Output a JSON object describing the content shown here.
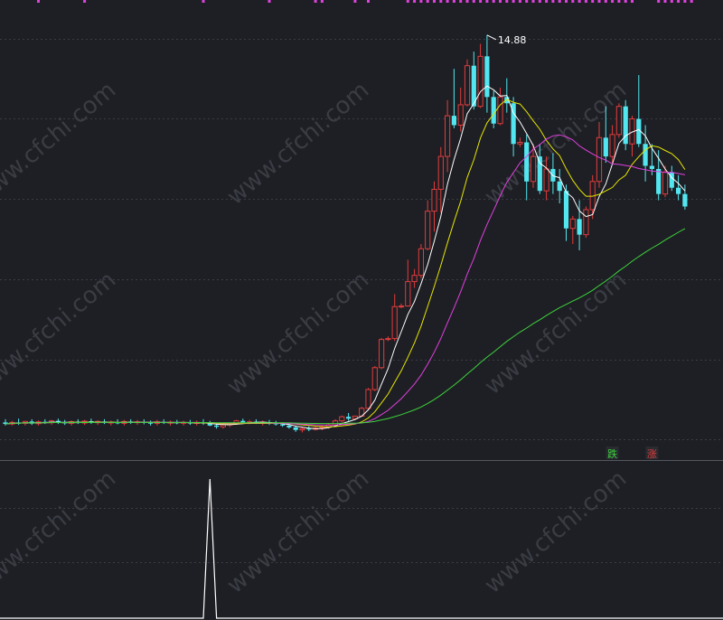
{
  "watermark": "www.cfchi.com",
  "colors": {
    "background": "#1e1f24",
    "grid": "#3a3c46",
    "up": "#e03c3c",
    "down": "#52e6f0",
    "ma5": "#ffffff",
    "ma10": "#e6e600",
    "ma20": "#e040e0",
    "ma60": "#3cd23c",
    "signal_marks": "#e040e0",
    "indicator_line": "#ffffff"
  },
  "chart_data": [
    {
      "type": "candlestick",
      "title": "",
      "max_label": "14.88",
      "ylim": [
        1.5,
        16.0
      ],
      "series_lines": [
        "MA5",
        "MA10",
        "MA20",
        "MA60"
      ],
      "candles": [
        {
          "o": 2.5,
          "h": 2.6,
          "l": 2.4,
          "c": 2.45
        },
        {
          "o": 2.45,
          "h": 2.55,
          "l": 2.4,
          "c": 2.5
        },
        {
          "o": 2.5,
          "h": 2.62,
          "l": 2.42,
          "c": 2.47
        },
        {
          "o": 2.47,
          "h": 2.55,
          "l": 2.4,
          "c": 2.53
        },
        {
          "o": 2.53,
          "h": 2.6,
          "l": 2.42,
          "c": 2.46
        },
        {
          "o": 2.46,
          "h": 2.56,
          "l": 2.4,
          "c": 2.52
        },
        {
          "o": 2.52,
          "h": 2.6,
          "l": 2.45,
          "c": 2.49
        },
        {
          "o": 2.49,
          "h": 2.58,
          "l": 2.42,
          "c": 2.55
        },
        {
          "o": 2.55,
          "h": 2.62,
          "l": 2.45,
          "c": 2.5
        },
        {
          "o": 2.5,
          "h": 2.58,
          "l": 2.42,
          "c": 2.47
        },
        {
          "o": 2.47,
          "h": 2.56,
          "l": 2.4,
          "c": 2.52
        },
        {
          "o": 2.52,
          "h": 2.6,
          "l": 2.45,
          "c": 2.48
        },
        {
          "o": 2.48,
          "h": 2.58,
          "l": 2.42,
          "c": 2.54
        },
        {
          "o": 2.54,
          "h": 2.62,
          "l": 2.45,
          "c": 2.49
        },
        {
          "o": 2.49,
          "h": 2.57,
          "l": 2.42,
          "c": 2.53
        },
        {
          "o": 2.53,
          "h": 2.6,
          "l": 2.45,
          "c": 2.48
        },
        {
          "o": 2.48,
          "h": 2.56,
          "l": 2.4,
          "c": 2.51
        },
        {
          "o": 2.51,
          "h": 2.6,
          "l": 2.44,
          "c": 2.47
        },
        {
          "o": 2.47,
          "h": 2.58,
          "l": 2.4,
          "c": 2.53
        },
        {
          "o": 2.53,
          "h": 2.6,
          "l": 2.45,
          "c": 2.5
        },
        {
          "o": 2.5,
          "h": 2.58,
          "l": 2.42,
          "c": 2.52
        },
        {
          "o": 2.52,
          "h": 2.6,
          "l": 2.44,
          "c": 2.49
        },
        {
          "o": 2.49,
          "h": 2.56,
          "l": 2.4,
          "c": 2.47
        },
        {
          "o": 2.47,
          "h": 2.58,
          "l": 2.4,
          "c": 2.52
        },
        {
          "o": 2.52,
          "h": 2.6,
          "l": 2.45,
          "c": 2.48
        },
        {
          "o": 2.48,
          "h": 2.56,
          "l": 2.4,
          "c": 2.51
        },
        {
          "o": 2.51,
          "h": 2.58,
          "l": 2.44,
          "c": 2.48
        },
        {
          "o": 2.48,
          "h": 2.55,
          "l": 2.4,
          "c": 2.5
        },
        {
          "o": 2.5,
          "h": 2.58,
          "l": 2.42,
          "c": 2.47
        },
        {
          "o": 2.47,
          "h": 2.56,
          "l": 2.4,
          "c": 2.5
        },
        {
          "o": 2.5,
          "h": 2.6,
          "l": 2.42,
          "c": 2.48
        },
        {
          "o": 2.48,
          "h": 2.55,
          "l": 2.38,
          "c": 2.4
        },
        {
          "o": 2.4,
          "h": 2.48,
          "l": 2.3,
          "c": 2.36
        },
        {
          "o": 2.36,
          "h": 2.45,
          "l": 2.3,
          "c": 2.42
        },
        {
          "o": 2.42,
          "h": 2.5,
          "l": 2.35,
          "c": 2.48
        },
        {
          "o": 2.48,
          "h": 2.58,
          "l": 2.42,
          "c": 2.55
        },
        {
          "o": 2.55,
          "h": 2.62,
          "l": 2.45,
          "c": 2.5
        },
        {
          "o": 2.5,
          "h": 2.58,
          "l": 2.44,
          "c": 2.52
        },
        {
          "o": 2.52,
          "h": 2.6,
          "l": 2.45,
          "c": 2.48
        },
        {
          "o": 2.48,
          "h": 2.56,
          "l": 2.4,
          "c": 2.51
        },
        {
          "o": 2.51,
          "h": 2.58,
          "l": 2.42,
          "c": 2.47
        },
        {
          "o": 2.47,
          "h": 2.55,
          "l": 2.4,
          "c": 2.44
        },
        {
          "o": 2.44,
          "h": 2.5,
          "l": 2.36,
          "c": 2.4
        },
        {
          "o": 2.4,
          "h": 2.46,
          "l": 2.3,
          "c": 2.34
        },
        {
          "o": 2.34,
          "h": 2.4,
          "l": 2.2,
          "c": 2.26
        },
        {
          "o": 2.26,
          "h": 2.35,
          "l": 2.18,
          "c": 2.3
        },
        {
          "o": 2.3,
          "h": 2.38,
          "l": 2.22,
          "c": 2.28
        },
        {
          "o": 2.28,
          "h": 2.36,
          "l": 2.24,
          "c": 2.32
        },
        {
          "o": 2.32,
          "h": 2.4,
          "l": 2.25,
          "c": 2.35
        },
        {
          "o": 2.35,
          "h": 2.45,
          "l": 2.3,
          "c": 2.42
        },
        {
          "o": 2.42,
          "h": 2.6,
          "l": 2.4,
          "c": 2.55
        },
        {
          "o": 2.55,
          "h": 2.72,
          "l": 2.5,
          "c": 2.68
        },
        {
          "o": 2.68,
          "h": 2.8,
          "l": 2.55,
          "c": 2.62
        },
        {
          "o": 2.62,
          "h": 2.72,
          "l": 2.58,
          "c": 2.7
        },
        {
          "o": 2.7,
          "h": 3.0,
          "l": 2.68,
          "c": 2.95
        },
        {
          "o": 2.95,
          "h": 3.6,
          "l": 2.9,
          "c": 3.55
        },
        {
          "o": 3.55,
          "h": 4.3,
          "l": 3.5,
          "c": 4.25
        },
        {
          "o": 4.25,
          "h": 5.2,
          "l": 4.2,
          "c": 5.15
        },
        {
          "o": 5.15,
          "h": 5.25,
          "l": 5.1,
          "c": 5.18
        },
        {
          "o": 5.18,
          "h": 6.6,
          "l": 5.1,
          "c": 6.2
        },
        {
          "o": 6.2,
          "h": 6.3,
          "l": 6.15,
          "c": 6.22
        },
        {
          "o": 6.22,
          "h": 7.7,
          "l": 6.2,
          "c": 7.0
        },
        {
          "o": 7.0,
          "h": 7.4,
          "l": 6.8,
          "c": 7.2
        },
        {
          "o": 7.2,
          "h": 8.2,
          "l": 7.1,
          "c": 8.05
        },
        {
          "o": 8.05,
          "h": 9.6,
          "l": 8.0,
          "c": 9.25
        },
        {
          "o": 9.25,
          "h": 10.2,
          "l": 8.6,
          "c": 9.95
        },
        {
          "o": 9.95,
          "h": 11.3,
          "l": 9.2,
          "c": 11.0
        },
        {
          "o": 11.0,
          "h": 12.8,
          "l": 10.5,
          "c": 12.3
        },
        {
          "o": 12.3,
          "h": 13.8,
          "l": 11.9,
          "c": 12.0
        },
        {
          "o": 12.0,
          "h": 13.2,
          "l": 11.8,
          "c": 12.65
        },
        {
          "o": 12.65,
          "h": 14.1,
          "l": 12.6,
          "c": 13.9
        },
        {
          "o": 13.9,
          "h": 14.35,
          "l": 12.5,
          "c": 12.6
        },
        {
          "o": 12.6,
          "h": 14.6,
          "l": 12.55,
          "c": 14.2
        },
        {
          "o": 14.2,
          "h": 14.88,
          "l": 12.4,
          "c": 12.9
        },
        {
          "o": 12.9,
          "h": 13.1,
          "l": 11.9,
          "c": 12.05
        },
        {
          "o": 12.05,
          "h": 13.2,
          "l": 12.0,
          "c": 12.9
        },
        {
          "o": 12.9,
          "h": 13.5,
          "l": 12.4,
          "c": 12.7
        },
        {
          "o": 12.7,
          "h": 12.9,
          "l": 11.0,
          "c": 11.4
        },
        {
          "o": 11.4,
          "h": 11.6,
          "l": 11.3,
          "c": 11.45
        },
        {
          "o": 11.45,
          "h": 11.7,
          "l": 9.6,
          "c": 10.2
        },
        {
          "o": 10.2,
          "h": 11.4,
          "l": 10.0,
          "c": 11.0
        },
        {
          "o": 11.0,
          "h": 11.4,
          "l": 9.8,
          "c": 9.9
        },
        {
          "o": 9.9,
          "h": 11.0,
          "l": 9.6,
          "c": 10.6
        },
        {
          "o": 10.6,
          "h": 11.1,
          "l": 9.8,
          "c": 10.2
        },
        {
          "o": 10.2,
          "h": 10.6,
          "l": 9.5,
          "c": 9.9
        },
        {
          "o": 9.9,
          "h": 10.1,
          "l": 8.3,
          "c": 8.7
        },
        {
          "o": 8.7,
          "h": 9.1,
          "l": 8.2,
          "c": 9.0
        },
        {
          "o": 9.0,
          "h": 9.6,
          "l": 8.0,
          "c": 8.5
        },
        {
          "o": 8.5,
          "h": 9.4,
          "l": 8.4,
          "c": 9.3
        },
        {
          "o": 9.3,
          "h": 10.4,
          "l": 9.0,
          "c": 10.2
        },
        {
          "o": 10.2,
          "h": 12.1,
          "l": 10.0,
          "c": 11.6
        },
        {
          "o": 11.6,
          "h": 12.6,
          "l": 10.8,
          "c": 11.0
        },
        {
          "o": 11.0,
          "h": 12.0,
          "l": 10.8,
          "c": 11.7
        },
        {
          "o": 11.7,
          "h": 12.7,
          "l": 11.6,
          "c": 12.6
        },
        {
          "o": 12.6,
          "h": 12.8,
          "l": 11.2,
          "c": 11.4
        },
        {
          "o": 11.4,
          "h": 12.3,
          "l": 11.0,
          "c": 12.2
        },
        {
          "o": 12.2,
          "h": 13.6,
          "l": 11.3,
          "c": 11.4
        },
        {
          "o": 11.4,
          "h": 12.0,
          "l": 10.2,
          "c": 10.7
        },
        {
          "o": 10.7,
          "h": 11.4,
          "l": 10.4,
          "c": 10.6
        },
        {
          "o": 10.6,
          "h": 11.2,
          "l": 9.6,
          "c": 9.8
        },
        {
          "o": 9.8,
          "h": 10.7,
          "l": 9.7,
          "c": 10.5
        },
        {
          "o": 10.5,
          "h": 10.7,
          "l": 9.9,
          "c": 10.0
        },
        {
          "o": 10.0,
          "h": 10.4,
          "l": 9.6,
          "c": 9.8
        },
        {
          "o": 9.8,
          "h": 10.1,
          "l": 9.3,
          "c": 9.4
        }
      ],
      "signals": [
        {
          "label": "跌",
          "index": 92,
          "color": "#3cd23c"
        },
        {
          "label": "涨",
          "index": 98,
          "color": "#e03c3c"
        }
      ],
      "top_marks": [
        5,
        12,
        30,
        40,
        47,
        48,
        53,
        55,
        61,
        62,
        63,
        64,
        65,
        66,
        67,
        68,
        69,
        70,
        71,
        72,
        73,
        74,
        75,
        76,
        77,
        78,
        79,
        80,
        81,
        82,
        83,
        84,
        85,
        86,
        87,
        88,
        89,
        90,
        91,
        92,
        93,
        94,
        95,
        99,
        100,
        101,
        102,
        103,
        104
      ]
    },
    {
      "type": "line",
      "title": "",
      "ylim": [
        0,
        1
      ],
      "values": [
        0,
        0,
        0,
        0,
        0,
        0,
        0,
        0,
        0,
        0,
        0,
        0,
        0,
        0,
        0,
        0,
        0,
        0,
        0,
        0,
        0,
        0,
        0,
        0,
        0,
        0,
        0,
        0,
        0,
        0,
        0,
        1,
        0,
        0,
        0,
        0,
        0,
        0,
        0,
        0,
        0,
        0,
        0,
        0,
        0,
        0,
        0,
        0,
        0,
        0,
        0,
        0,
        0,
        0,
        0,
        0,
        0,
        0,
        0,
        0,
        0,
        0,
        0,
        0,
        0,
        0,
        0,
        0,
        0,
        0,
        0,
        0,
        0,
        0,
        0,
        0,
        0,
        0,
        0,
        0,
        0,
        0,
        0,
        0,
        0,
        0,
        0,
        0,
        0,
        0,
        0,
        0,
        0,
        0,
        0,
        0,
        0,
        0,
        0,
        0,
        0,
        0,
        0,
        0,
        0,
        0,
        0,
        0,
        0
      ]
    }
  ]
}
